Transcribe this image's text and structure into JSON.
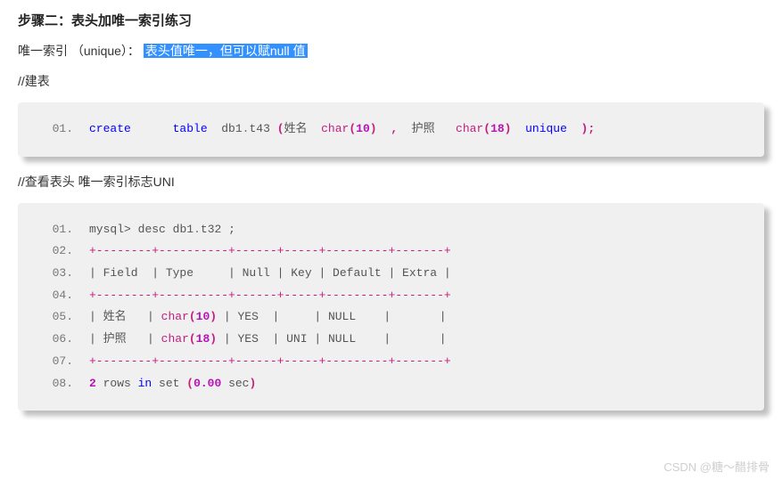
{
  "heading": "步骤二：表头加唯一索引练习",
  "intro_prefix": "唯一索引 （unique）：",
  "intro_highlight": "表头值唯一，但可以赋null 值",
  "comment1": "//建表",
  "comment2": "//查看表头 唯一索引标志UNI",
  "block1": {
    "line1_no": "01.",
    "create_kw": "create",
    "table_kw": "table",
    "db": "db1",
    "tbl": "t43",
    "col1": "姓名",
    "char_kw": "char",
    "col1_size": "10",
    "col2": "护照",
    "col2_size": "18",
    "unique_kw": "unique"
  },
  "block2": {
    "l1_no": "01.",
    "l2_no": "02.",
    "l3_no": "03.",
    "l4_no": "04.",
    "l5_no": "05.",
    "l6_no": "06.",
    "l7_no": "07.",
    "l8_no": "08.",
    "prompt": "mysql",
    "gt": ">",
    "desc": "desc",
    "db": "db1",
    "tbl": "t32",
    "semi": ";",
    "border": "+--------+----------+------+-----+---------+-------+",
    "header": "| Field  | Type     | Null | Key | Default | Extra |",
    "row1_field": "姓名",
    "row1_size": "10",
    "row1_null": "YES",
    "row1_key": "   ",
    "row1_default": "NULL",
    "row2_field": "护照",
    "row2_size": "18",
    "row2_null": "YES",
    "row2_key": "UNI",
    "row2_default": "NULL",
    "footer_count": "2",
    "footer_rows": " rows ",
    "footer_in": "in",
    "footer_set": " set ",
    "footer_time": "0.00",
    "footer_sec": " sec"
  },
  "watermark": "CSDN @糖～醋排骨"
}
